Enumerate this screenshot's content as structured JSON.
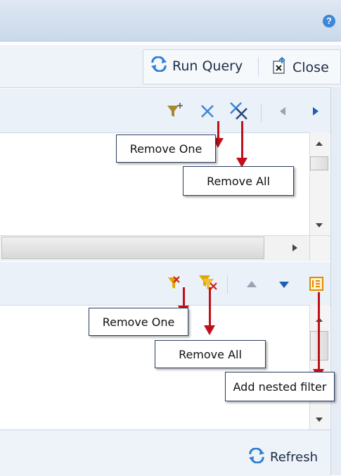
{
  "toolbar": {
    "run_query_label": "Run Query",
    "close_label": "Close"
  },
  "callouts": {
    "top_remove_one": "Remove One",
    "top_remove_all": "Remove All",
    "bottom_remove_one": "Remove One",
    "bottom_remove_all": "Remove All",
    "add_nested_filter": "Add nested filter"
  },
  "footer": {
    "refresh_label": "Refresh"
  },
  "icons": {
    "help": "help-icon",
    "run_query": "refresh-icon",
    "close": "close-document-icon",
    "add_filter": "add-filter-icon",
    "remove_one": "remove-x-icon",
    "remove_all": "remove-all-x-icon",
    "nav_left": "chevron-left-icon",
    "nav_right": "chevron-right-icon",
    "move_up": "arrow-up-icon",
    "move_down": "arrow-down-icon",
    "nested_filter": "nested-filter-icon"
  },
  "colors": {
    "annotation_arrow": "#c0101a",
    "accent_blue": "#1f5fb0",
    "filter_yellow": "#e0a800",
    "remove_red": "#d42020"
  }
}
